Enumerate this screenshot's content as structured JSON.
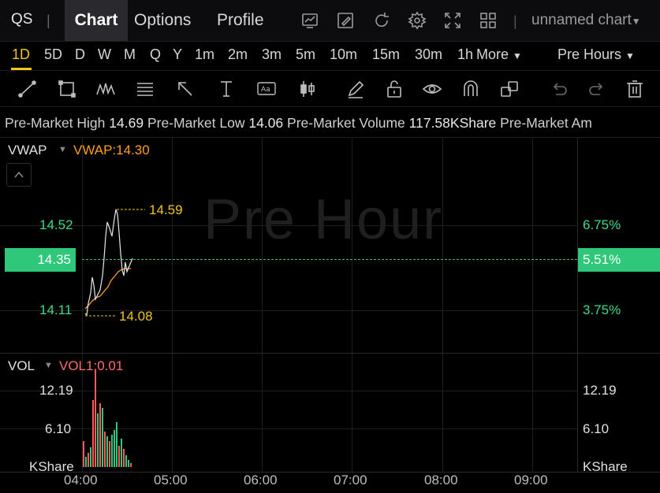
{
  "header": {
    "ticker": "QS",
    "tabs": [
      {
        "label": "Chart",
        "active": true
      },
      {
        "label": "Options",
        "active": false
      },
      {
        "label": "Profile",
        "active": false
      }
    ],
    "icons": [
      "chart-type-icon",
      "draw-icon",
      "refresh-icon",
      "settings-icon",
      "fullscreen-icon",
      "layout-icon"
    ],
    "chart_name": "unnamed chart"
  },
  "intervals": {
    "items": [
      "1D",
      "5D",
      "D",
      "W",
      "M",
      "Q",
      "Y",
      "1m",
      "2m",
      "3m",
      "5m",
      "10m",
      "15m",
      "30m",
      "1h"
    ],
    "active": "1D",
    "more_label": "More",
    "session_label": "Pre Hours"
  },
  "draw_tools": [
    "trend-line-icon",
    "rectangle-icon",
    "pattern-icon",
    "fib-icon",
    "arrow-icon",
    "measure-icon",
    "text-annotation-icon",
    "candle-icon",
    "pen-icon",
    "unlock-icon",
    "eye-icon",
    "magnet-icon",
    "clone-icon",
    "undo-icon",
    "redo-icon",
    "trash-icon"
  ],
  "info": {
    "high_label": "Pre-Market High",
    "high": "14.69",
    "low_label": "Pre-Market Low",
    "low": "14.06",
    "volume_label": "Pre-Market Volume",
    "volume": "117.58KShare",
    "amount_label": "Pre-Market Am"
  },
  "price_panel": {
    "indicator_label": "VWAP",
    "indicator_value": "VWAP:14.30",
    "watermark": "Pre Hour",
    "left_ticks": [
      "14.52",
      "14.11"
    ],
    "right_ticks": [
      "6.75%",
      "3.75%"
    ],
    "current_price": "14.35",
    "current_pct": "5.51%",
    "high_marker": "14.59",
    "low_marker": "14.08"
  },
  "volume_panel": {
    "indicator_label": "VOL",
    "indicator_value": "VOL1:0.01",
    "left_ticks": [
      "12.19",
      "6.10",
      "KShare"
    ],
    "right_ticks": [
      "12.19",
      "6.10",
      "KShare"
    ]
  },
  "x_axis": [
    "04:00",
    "05:00",
    "06:00",
    "07:00",
    "08:00",
    "09:00"
  ],
  "colors": {
    "up": "#2fc77a",
    "down": "#ff5a5a",
    "accent": "#f0c419",
    "vwap": "#ff9f1a"
  }
}
